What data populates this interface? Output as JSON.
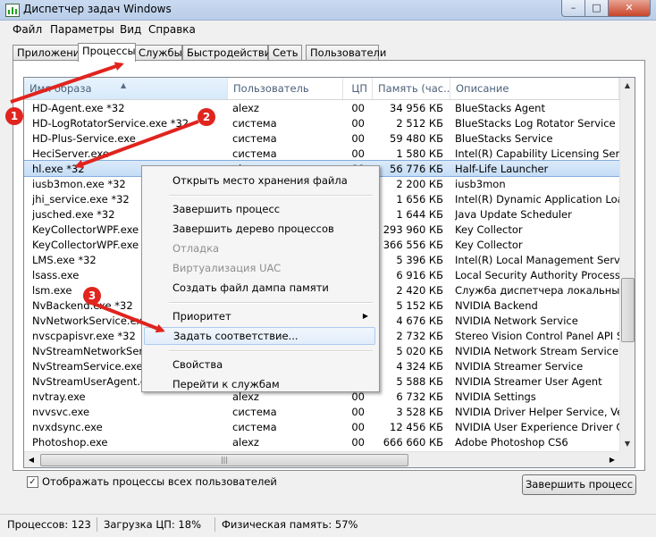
{
  "window": {
    "title": "Диспетчер задач Windows",
    "controls": {
      "minimize": "–",
      "maximize": "□",
      "close": "✕"
    }
  },
  "menu": [
    "Файл",
    "Параметры",
    "Вид",
    "Справка"
  ],
  "tabs": [
    "Приложения",
    "Процессы",
    "Службы",
    "Быстродействие",
    "Сеть",
    "Пользователи"
  ],
  "active_tab": "Процессы",
  "columns": [
    "Имя образа",
    "Пользователь",
    "ЦП",
    "Память (час...",
    "Описание"
  ],
  "sorted_column": "Имя образа",
  "processes": [
    {
      "name": "HD-Agent.exe *32",
      "user": "alexz",
      "cpu": "00",
      "mem": "34 956 КБ",
      "desc": "BlueStacks Agent"
    },
    {
      "name": "HD-LogRotatorService.exe *32",
      "user": "система",
      "cpu": "00",
      "mem": "2 512 КБ",
      "desc": "BlueStacks Log Rotator Service"
    },
    {
      "name": "HD-Plus-Service.exe",
      "user": "система",
      "cpu": "00",
      "mem": "59 480 КБ",
      "desc": "BlueStacks Service"
    },
    {
      "name": "HeciServer.exe",
      "user": "система",
      "cpu": "00",
      "mem": "1 580 КБ",
      "desc": "Intel(R) Capability Licensing Service In"
    },
    {
      "name": "hl.exe *32",
      "user": "alexz",
      "cpu": "00",
      "mem": "56 776 КБ",
      "desc": "Half-Life Launcher",
      "selected": true
    },
    {
      "name": "iusb3mon.exe *32",
      "user": "",
      "cpu": "",
      "mem": "2 200 КБ",
      "desc": "iusb3mon"
    },
    {
      "name": "jhi_service.exe *32",
      "user": "",
      "cpu": "",
      "mem": "1 656 КБ",
      "desc": "Intel(R) Dynamic Application Loader Ho"
    },
    {
      "name": "jusched.exe *32",
      "user": "",
      "cpu": "",
      "mem": "1 644 КБ",
      "desc": "Java Update Scheduler"
    },
    {
      "name": "KeyCollectorWPF.exe *32",
      "user": "",
      "cpu": "",
      "mem": "293 960 КБ",
      "desc": "Key Collector"
    },
    {
      "name": "KeyCollectorWPF.exe *32",
      "user": "",
      "cpu": "",
      "mem": "366 556 КБ",
      "desc": "Key Collector"
    },
    {
      "name": "LMS.exe *32",
      "user": "",
      "cpu": "",
      "mem": "5 396 КБ",
      "desc": "Intel(R) Local Management Service"
    },
    {
      "name": "lsass.exe",
      "user": "",
      "cpu": "",
      "mem": "6 916 КБ",
      "desc": "Local Security Authority Process"
    },
    {
      "name": "lsm.exe",
      "user": "",
      "cpu": "",
      "mem": "2 420 КБ",
      "desc": "Служба диспетчера локальных сеан"
    },
    {
      "name": "NvBackend.exe *32",
      "user": "",
      "cpu": "",
      "mem": "5 152 КБ",
      "desc": "NVIDIA Backend"
    },
    {
      "name": "NvNetworkService.exe *32",
      "user": "",
      "cpu": "",
      "mem": "4 676 КБ",
      "desc": "NVIDIA Network Service"
    },
    {
      "name": "nvscpapisvr.exe *32",
      "user": "",
      "cpu": "",
      "mem": "2 732 КБ",
      "desc": "Stereo Vision Control Panel API Server"
    },
    {
      "name": "NvStreamNetworkService.exe",
      "user": "",
      "cpu": "",
      "mem": "5 020 КБ",
      "desc": "NVIDIA Network Stream Service"
    },
    {
      "name": "NvStreamService.exe",
      "user": "",
      "cpu": "",
      "mem": "4 324 КБ",
      "desc": "NVIDIA Streamer Service"
    },
    {
      "name": "NvStreamUserAgent.exe",
      "user": "",
      "cpu": "",
      "mem": "5 588 КБ",
      "desc": "NVIDIA Streamer User Agent"
    },
    {
      "name": "nvtray.exe",
      "user": "alexz",
      "cpu": "00",
      "mem": "6 732 КБ",
      "desc": "NVIDIA Settings"
    },
    {
      "name": "nvvsvc.exe",
      "user": "система",
      "cpu": "00",
      "mem": "3 528 КБ",
      "desc": "NVIDIA Driver Helper Service, Version"
    },
    {
      "name": "nvxdsync.exe",
      "user": "система",
      "cpu": "00",
      "mem": "12 456 КБ",
      "desc": "NVIDIA User Experience Driver Compo"
    },
    {
      "name": "Photoshop.exe",
      "user": "alexz",
      "cpu": "00",
      "mem": "666 660 КБ",
      "desc": "Adobe Photoshop CS6"
    }
  ],
  "context_menu": {
    "items": [
      {
        "label": "Открыть место хранения файла",
        "disabled": false
      },
      {
        "separator": true
      },
      {
        "label": "Завершить процесс",
        "disabled": false
      },
      {
        "label": "Завершить дерево процессов",
        "disabled": false
      },
      {
        "label": "Отладка",
        "disabled": true
      },
      {
        "label": "Виртуализация UAC",
        "disabled": true
      },
      {
        "label": "Создать файл дампа памяти",
        "disabled": false
      },
      {
        "separator": true
      },
      {
        "label": "Приоритет",
        "disabled": false,
        "submenu": true
      },
      {
        "label": "Задать соответствие...",
        "disabled": false,
        "hover": true
      },
      {
        "separator": true
      },
      {
        "label": "Свойства",
        "disabled": false
      },
      {
        "label": "Перейти к службам",
        "disabled": false
      }
    ]
  },
  "checkbox": {
    "label": "Отображать процессы всех пользователей",
    "checked": true
  },
  "end_process_button": "Завершить процесс",
  "status": {
    "processes": "Процессов: 123",
    "cpu": "Загрузка ЦП: 18%",
    "memory": "Физическая память: 57%"
  },
  "annotations": {
    "badges": [
      "1",
      "2",
      "3"
    ],
    "color": "#e0241e"
  }
}
